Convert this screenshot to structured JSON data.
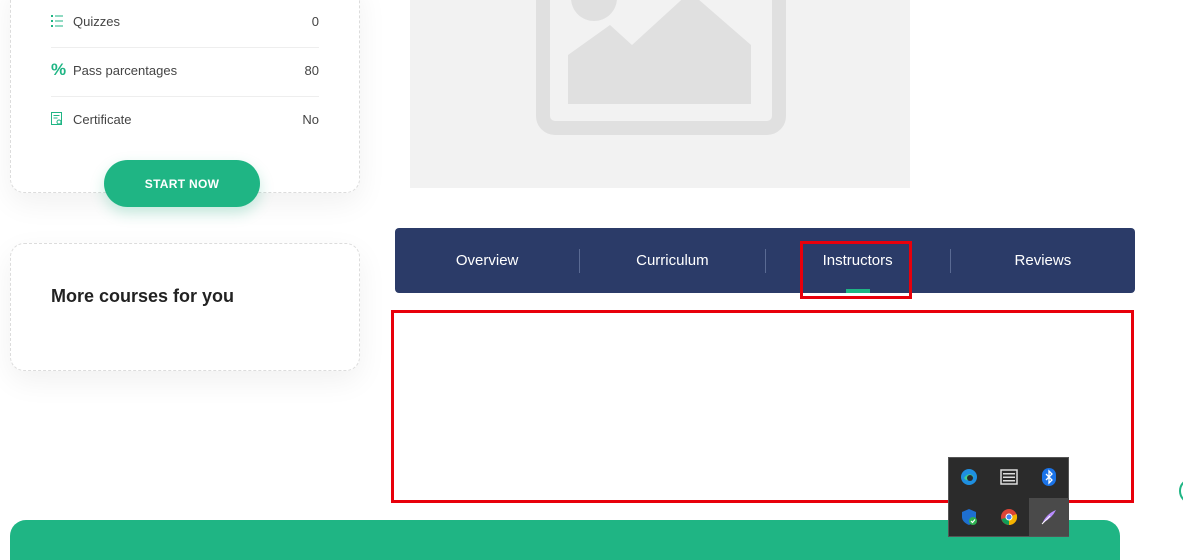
{
  "course_info": {
    "rows": [
      {
        "icon": "list-icon",
        "label": "Quizzes",
        "value": "0"
      },
      {
        "icon": "percent-icon",
        "label": "Pass parcentages",
        "value": "80"
      },
      {
        "icon": "certificate-icon",
        "label": "Certificate",
        "value": "No"
      }
    ],
    "start_button": "START NOW"
  },
  "more_courses": {
    "title": "More courses for you"
  },
  "tabs": [
    {
      "label": "Overview"
    },
    {
      "label": "Curriculum"
    },
    {
      "label": "Instructors",
      "active": true
    },
    {
      "label": "Reviews"
    }
  ],
  "colors": {
    "accent": "#1fb584",
    "tab_bar": "#2b3b68",
    "highlight": "#e8000b"
  },
  "tray_icons": [
    "edge-icon",
    "settings-panel-icon",
    "bluetooth-icon",
    "security-shield-icon",
    "chrome-icon",
    "feather-pen-icon"
  ]
}
